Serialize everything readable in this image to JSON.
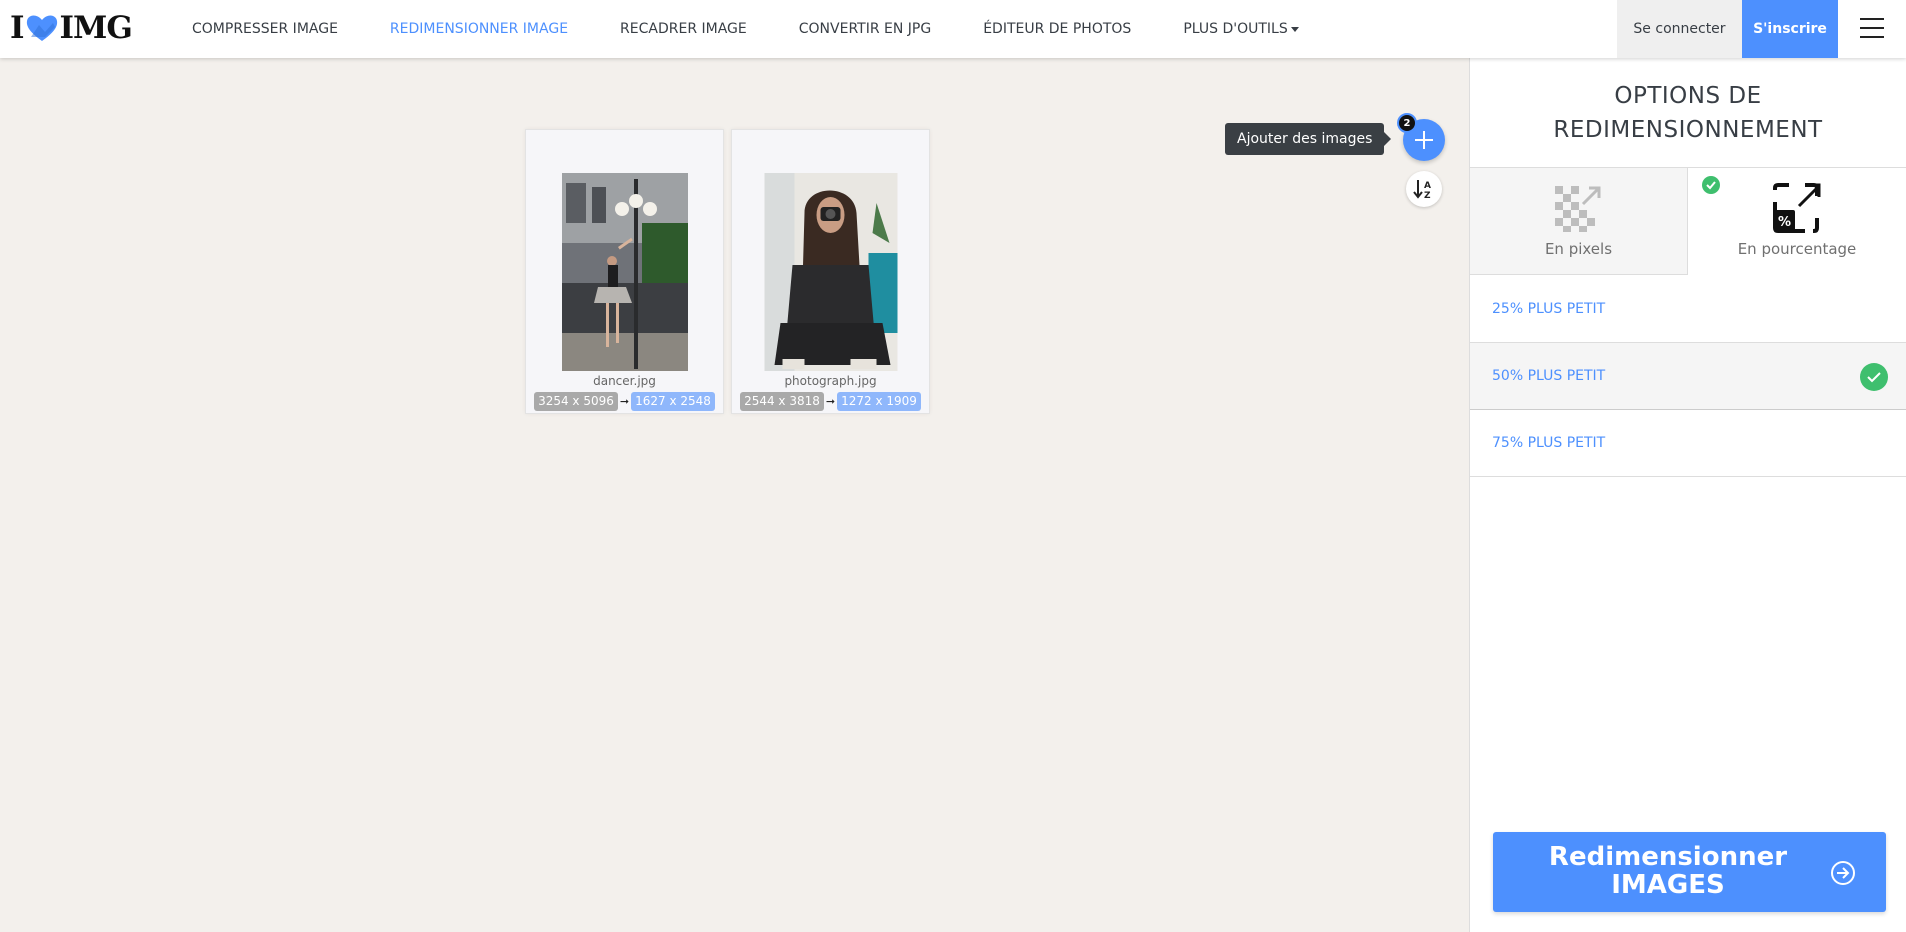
{
  "brand": {
    "left": "I",
    "right": "IMG",
    "accent": "#4d90fe"
  },
  "nav": {
    "items": [
      {
        "label": "COMPRESSER IMAGE"
      },
      {
        "label": "REDIMENSIONNER IMAGE"
      },
      {
        "label": "RECADRER IMAGE"
      },
      {
        "label": "CONVERTIR EN JPG"
      },
      {
        "label": "ÉDITEUR DE PHOTOS"
      },
      {
        "label": "PLUS D'OUTILS"
      }
    ],
    "active_index": 1,
    "login": "Se connecter",
    "signup": "S'inscrire"
  },
  "workspace": {
    "files": [
      {
        "name": "dancer.jpg",
        "original": "3254 x 5096",
        "resized": "1627 x 2548",
        "arrow": "➞"
      },
      {
        "name": "photograph.jpg",
        "original": "2544 x 3818",
        "resized": "1272 x 1909",
        "arrow": "➞"
      }
    ],
    "add_tooltip": "Ajouter des images",
    "file_count": "2",
    "add_icon": "plus-icon",
    "sort_icon": "sort-az-icon"
  },
  "sidebar": {
    "title": "OPTIONS DE REDIMENSIONNEMENT",
    "modes": [
      {
        "label": "En pixels",
        "icon": "pixels-resize-icon",
        "active": false
      },
      {
        "label": "En pourcentage",
        "icon": "percentage-resize-icon",
        "active": true
      }
    ],
    "options": [
      {
        "label": "25% PLUS PETIT",
        "selected": false
      },
      {
        "label": "50% PLUS PETIT",
        "selected": true
      },
      {
        "label": "75% PLUS PETIT",
        "selected": false
      }
    ],
    "action": {
      "line1": "Redimensionner",
      "line2": "IMAGES",
      "icon": "arrow-circle-right-icon"
    }
  },
  "colors": {
    "primary": "#4d90fe",
    "check": "#3fbf6e",
    "dark": "#383e45",
    "background": "#f3f0ec"
  }
}
